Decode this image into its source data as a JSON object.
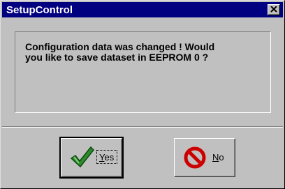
{
  "window": {
    "title": "SetupControl"
  },
  "message": {
    "text": "Configuration data was changed ! Would\nyou like to save dataset in EEPROM 0 ?"
  },
  "buttons": {
    "yes": {
      "accel": "Y",
      "rest": "es",
      "icon": "checkmark-icon"
    },
    "no": {
      "accel": "N",
      "rest": "o",
      "icon": "no-entry-icon"
    }
  },
  "colors": {
    "titlebar": "#000080",
    "face": "#c0c0c0",
    "check_green": "#2e8b2e",
    "no_red": "#cc0000"
  }
}
